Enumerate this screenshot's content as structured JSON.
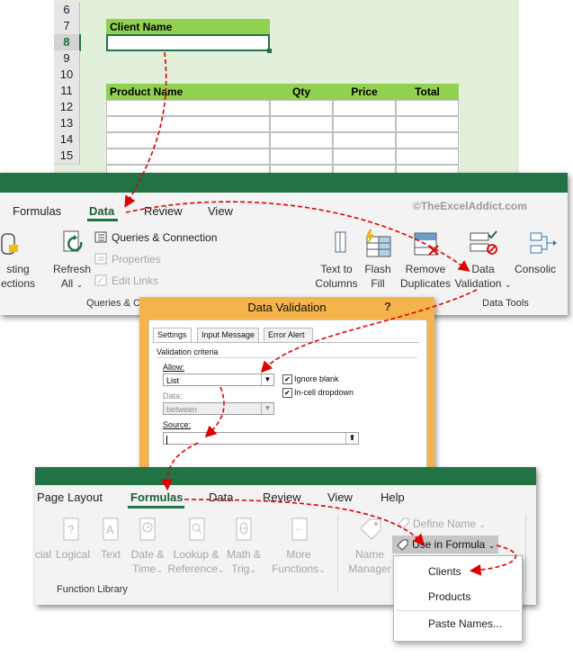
{
  "sheet": {
    "row_numbers": [
      "6",
      "7",
      "8",
      "9",
      "10",
      "11",
      "12",
      "13",
      "14",
      "15"
    ],
    "client_name_label": "Client Name",
    "table_headers": [
      "Product Name",
      "Qty",
      "Price",
      "Total"
    ]
  },
  "data_ribbon": {
    "tabs": [
      "Formulas",
      "Data",
      "Review",
      "View"
    ],
    "watermark": "©TheExcelAddict.com",
    "existing_connections_line1": "sting",
    "existing_connections_line2": "ections",
    "refresh_all_line1": "Refresh",
    "refresh_all_line2": "All",
    "queries_connections": "Queries & Connection",
    "properties": "Properties",
    "edit_links": "Edit Links",
    "group_queries": "Queries & C",
    "text_to_columns_line1": "Text to",
    "text_to_columns_line2": "Columns",
    "flash_fill_line1": "Flash",
    "flash_fill_line2": "Fill",
    "remove_duplicates_line1": "Remove",
    "remove_duplicates_line2": "Duplicates",
    "data_validation_line1": "Data",
    "data_validation_line2": "Validation",
    "consolidate": "Consolic",
    "group_data_tools": "Data Tools"
  },
  "dialog": {
    "title": "Data Validation",
    "help": "?",
    "tabs": [
      "Settings",
      "Input Message",
      "Error Alert"
    ],
    "validation_criteria": "Validation criteria",
    "allow_label": "Allow:",
    "allow_value": "List",
    "data_label": "Data:",
    "data_value": "between",
    "ignore_blank": "Ignore blank",
    "in_cell_dropdown": "In-cell dropdown",
    "source_label": "Source:",
    "source_value": ""
  },
  "formulas_ribbon": {
    "tabs": [
      "Page Layout",
      "Formulas",
      "Data",
      "Review",
      "View",
      "Help"
    ],
    "financial_partial": "cial",
    "logical": "Logical",
    "text": "Text",
    "date_time_line1": "Date &",
    "date_time_line2": "Time",
    "lookup_line1": "Lookup &",
    "lookup_line2": "Reference",
    "math_line1": "Math &",
    "math_line2": "Trig",
    "more_line1": "More",
    "more_line2": "Functions",
    "group_function_library": "Function Library",
    "name_manager_line1": "Name",
    "name_manager_line2": "Manager",
    "define_name": "Define Name",
    "use_in_formula": "Use in Formula"
  },
  "menu": {
    "items": [
      "Clients",
      "Products",
      "Paste Names..."
    ]
  },
  "colors": {
    "excel_green": "#217346",
    "header_green": "#92d050",
    "sheet_bg": "#e2efda",
    "dialog_frame": "#f5b34b",
    "arrow_red": "#e00000"
  }
}
